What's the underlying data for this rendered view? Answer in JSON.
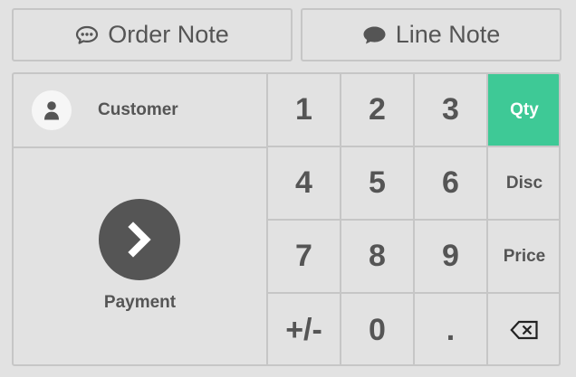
{
  "notes": {
    "order_note_label": "Order Note",
    "order_note_icon": "comment-dots-icon",
    "line_note_label": "Line Note",
    "line_note_icon": "comment-icon"
  },
  "customer": {
    "label": "Customer",
    "icon": "user-icon"
  },
  "payment": {
    "label": "Payment",
    "icon": "chevron-right-icon"
  },
  "numpad": {
    "keys": [
      "1",
      "2",
      "3",
      "Qty",
      "4",
      "5",
      "6",
      "Disc",
      "7",
      "8",
      "9",
      "Price",
      "+/-",
      "0",
      ".",
      ""
    ],
    "backspace_icon": "backspace-icon",
    "active_mode": "Qty"
  },
  "colors": {
    "background": "#e2e2e2",
    "border": "#c6c6c6",
    "text": "#555555",
    "accent": "#3ec996",
    "avatar_bg": "#f6f6f6"
  }
}
